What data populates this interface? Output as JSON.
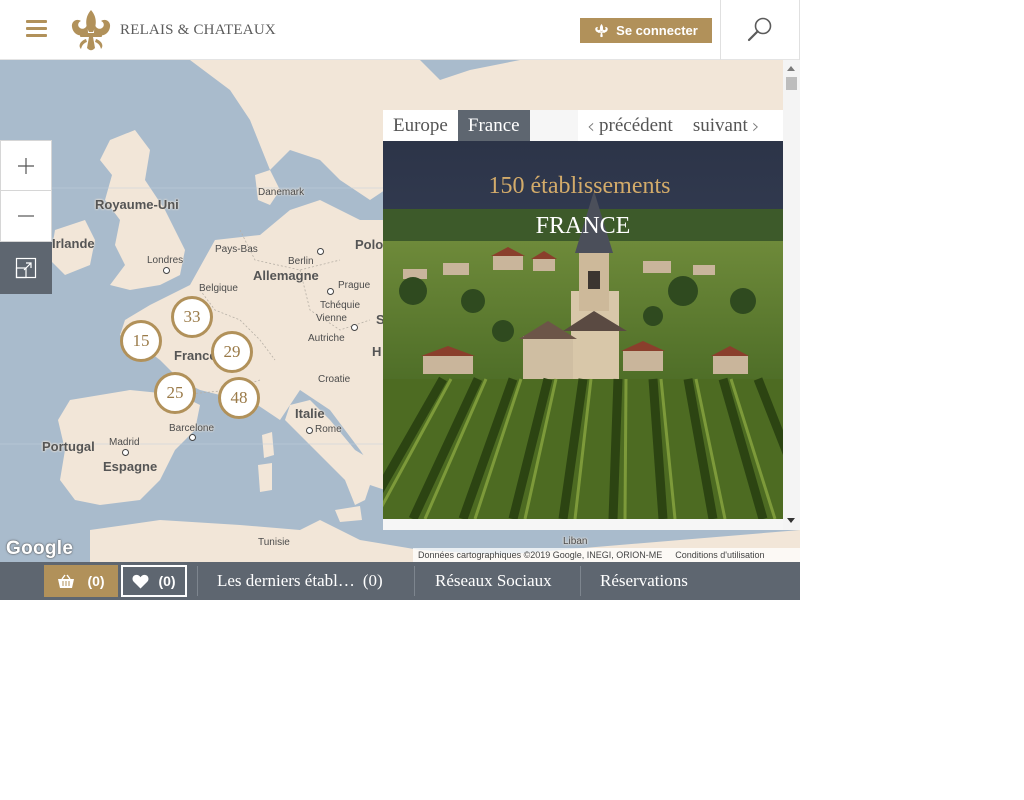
{
  "header": {
    "logo_text": "RELAIS & CHATEAUX",
    "connect_label": "Se connecter"
  },
  "map": {
    "labels": {
      "royaume_uni": "Royaume-Uni",
      "irlande": "Irlande",
      "londres": "Londres",
      "danemark": "Danemark",
      "pays_bas": "Pays-Bas",
      "berlin": "Berlin",
      "allemagne": "Allemagne",
      "belgique": "Belgique",
      "prague": "Prague",
      "tcheque": "Tchéquie",
      "vienne": "Vienne",
      "autriche": "Autriche",
      "polo": "Polo",
      "france": "France",
      "croatie": "Croatie",
      "italie": "Italie",
      "rome": "Rome",
      "barcelone": "Barcelone",
      "madrid": "Madrid",
      "portugal": "Portugal",
      "espagne": "Espagne",
      "tunisie": "Tunisie",
      "liban": "Liban",
      "s": "S",
      "h": "H"
    },
    "clusters": [
      "33",
      "15",
      "29",
      "25",
      "48"
    ],
    "google_logo": "Google",
    "attribution": "Données cartographiques ©2019 Google, INEGI, ORION-ME",
    "terms": "Conditions d'utilisation"
  },
  "panel": {
    "tabs": [
      "Europe",
      "France"
    ],
    "active_tab": "France",
    "prev_label": "précédent",
    "next_label": "suivant",
    "count_text": "150 établissements",
    "country_text": "FRANCE"
  },
  "bottombar": {
    "basket_count": "(0)",
    "favorites_count": "(0)",
    "latest_label": "Les derniers établ…",
    "latest_count": "(0)",
    "social_label": "Réseaux Sociaux",
    "reservations_label": "Réservations"
  },
  "colors": {
    "gold": "#b1915a",
    "slate": "#5e6670",
    "sea": "#a9bbcc",
    "land": "#f2e6d8"
  },
  "icons": {
    "menu": "hamburger-icon",
    "logo": "fleur-de-lis-icon",
    "search": "search-icon",
    "basket": "basket-icon",
    "favorites": "heart-icon",
    "zoom_in": "plus-icon",
    "zoom_out": "minus-icon",
    "fullscreen": "fullscreen-icon"
  }
}
